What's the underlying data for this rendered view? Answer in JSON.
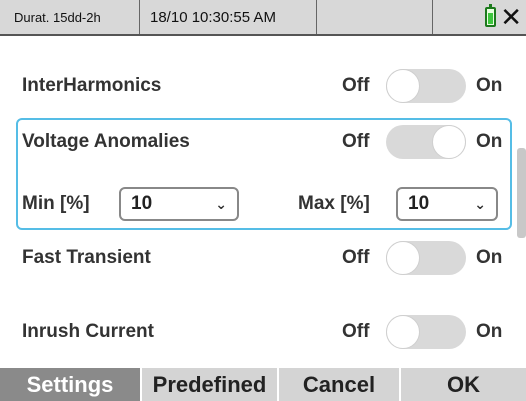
{
  "status": {
    "duration": "Durat. 15dd-2h",
    "datetime": "18/10 10:30:55 AM",
    "battery_icon": "battery-icon",
    "close_symbol": "✕"
  },
  "rows": {
    "interharmonics": {
      "label": "InterHarmonics",
      "off": "Off",
      "on": "On",
      "state": "off"
    },
    "voltage_anomalies": {
      "label": "Voltage Anomalies",
      "off": "Off",
      "on": "On",
      "state": "on"
    },
    "fast_transient": {
      "label": "Fast Transient",
      "off": "Off",
      "on": "On",
      "state": "off"
    },
    "inrush_current": {
      "label": "Inrush Current",
      "off": "Off",
      "on": "On",
      "state": "off"
    }
  },
  "thresholds": {
    "min_label": "Min [%]",
    "min_value": "10",
    "max_label": "Max [%]",
    "max_value": "10"
  },
  "bottom_bar": {
    "settings": "Settings",
    "predefined": "Predefined",
    "cancel": "Cancel",
    "ok": "OK"
  },
  "colors": {
    "highlight_border": "#55bde6",
    "active_tab": "#8a8a8a",
    "battery": "#3cc63c"
  }
}
